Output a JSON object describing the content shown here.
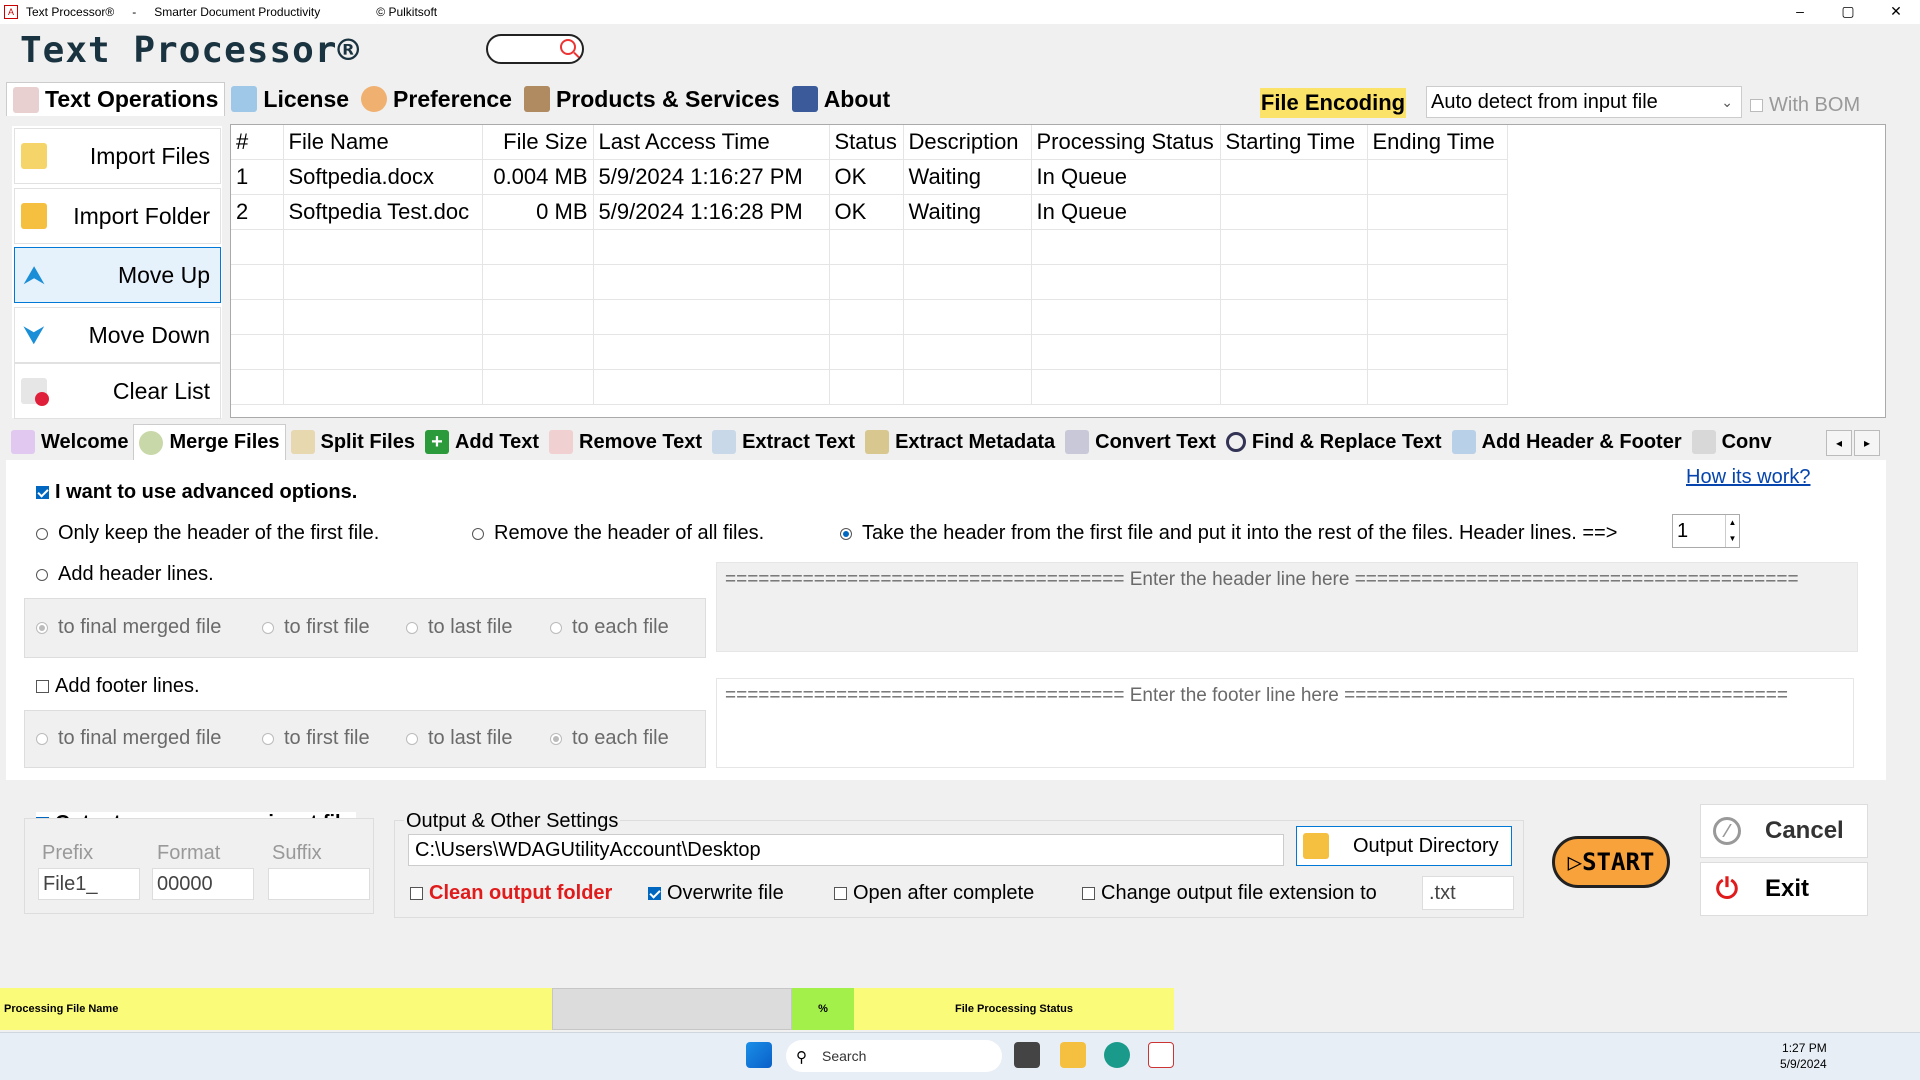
{
  "titlebar": {
    "app": "Text Processor®",
    "sep": "-",
    "tagline": "Smarter Document Productivity",
    "copyright": "© Pulkitsoft"
  },
  "app_title": "Text Processor®",
  "top_tabs": [
    "Text Operations",
    "License",
    "Preference",
    "Products & Services",
    "About"
  ],
  "file_encoding": {
    "label": "File Encoding",
    "value": "Auto detect from input file",
    "bom_label": "With BOM"
  },
  "left_buttons": [
    "Import Files",
    "Import Folder",
    "Move Up",
    "Move Down",
    "Clear List"
  ],
  "grid": {
    "columns": [
      "#",
      "File Name",
      "File Size",
      "Last Access Time",
      "Status",
      "Description",
      "Processing Status",
      "Starting Time",
      "Ending Time"
    ],
    "rows": [
      [
        "1",
        "Softpedia.docx",
        "0.004 MB",
        "5/9/2024 1:16:27 PM",
        "OK",
        "Waiting",
        "In Queue",
        "",
        ""
      ],
      [
        "2",
        "Softpedia Test.doc",
        "0 MB",
        "5/9/2024 1:16:28 PM",
        "OK",
        "Waiting",
        "In Queue",
        "",
        ""
      ]
    ]
  },
  "lower_tabs": [
    "Welcome",
    "Merge Files",
    "Split Files",
    "Add Text",
    "Remove Text",
    "Extract Text",
    "Extract Metadata",
    "Convert Text",
    "Find & Replace Text",
    "Add Header & Footer",
    "Conv"
  ],
  "merge": {
    "how_link": "How its work?",
    "advanced": "I want to use advanced options.",
    "opt_keep_first": "Only keep the header of the first file.",
    "opt_remove_all": "Remove the header of all files.",
    "opt_take_header": "Take the header from the first file and put it into the rest of the files. Header lines. ==>",
    "header_lines": "1",
    "add_header": "Add header lines.",
    "header_targets": [
      "to final merged file",
      "to first file",
      "to last file",
      "to each file"
    ],
    "header_placeholder": "==================================== Enter the header line here ========================================",
    "add_footer": "Add footer lines.",
    "footer_targets": [
      "to final merged file",
      "to first file",
      "to last file",
      "to each file"
    ],
    "footer_placeholder": "==================================== Enter the footer line here ========================================"
  },
  "output": {
    "same_name": "Output name same as input file",
    "prefix_label": "Prefix",
    "format_label": "Format",
    "suffix_label": "Suffix",
    "prefix": "File1_",
    "format": "00000",
    "suffix": "",
    "settings_title": "Output & Other Settings",
    "path": "C:\\Users\\WDAGUtilityAccount\\Desktop",
    "output_dir_btn": "Output Directory",
    "clean": "Clean output folder",
    "overwrite": "Overwrite file",
    "open_after": "Open after complete",
    "change_ext": "Change output file extension to",
    "ext": ".txt",
    "start": "START",
    "cancel": "Cancel",
    "exit": "Exit"
  },
  "statusbar": {
    "file_name": "Processing File Name",
    "percent": "%",
    "status": "File Processing Status"
  },
  "taskbar": {
    "search": "Search",
    "time": "1:27 PM",
    "date": "5/9/2024"
  },
  "colors": {
    "yellow": "#fbfb7a",
    "green": "#a4f04a",
    "accent": "#0078d7",
    "start": "#f7a23b",
    "red": "#e01b1b"
  }
}
